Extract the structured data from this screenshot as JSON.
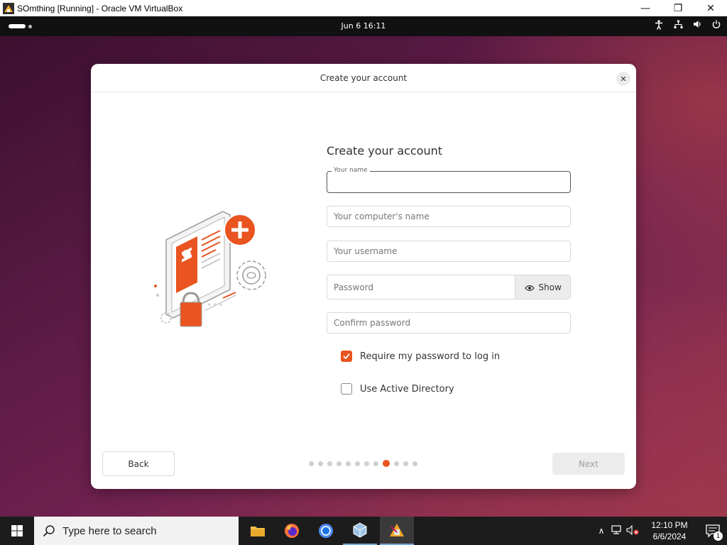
{
  "host": {
    "title": "SOmthing [Running] - Oracle VM VirtualBox",
    "minimize": "—",
    "restore": "❐",
    "close": "✕"
  },
  "vm": {
    "clock": "Jun 6  16:11",
    "tray": {
      "accessibility": "✝",
      "network": "⚯",
      "volume": "🔈",
      "power": "⏻"
    }
  },
  "dialog": {
    "header_title": "Create your account",
    "close": "✕",
    "form_title": "Create your account",
    "fields": {
      "your_name_label": "Your name",
      "your_name_value": "",
      "computer_name_placeholder": "Your computer's name",
      "username_placeholder": "Your username",
      "password_placeholder": "Password",
      "show_label": "Show",
      "confirm_password_placeholder": "Confirm password"
    },
    "checkboxes": {
      "require_password_label": "Require my password to log in",
      "require_password_checked": true,
      "active_directory_label": "Use Active Directory",
      "active_directory_checked": false
    },
    "back_label": "Back",
    "next_label": "Next",
    "pager": {
      "total": 12,
      "current": 9
    },
    "accent_color": "#e95420"
  },
  "taskbar": {
    "search_placeholder": "Type here to search",
    "apps": [
      "file-explorer",
      "firefox",
      "chrome",
      "virtualbox",
      "virtualbox-vm"
    ],
    "time": "12:10 PM",
    "date": "6/6/2024",
    "notification_count": "1"
  }
}
